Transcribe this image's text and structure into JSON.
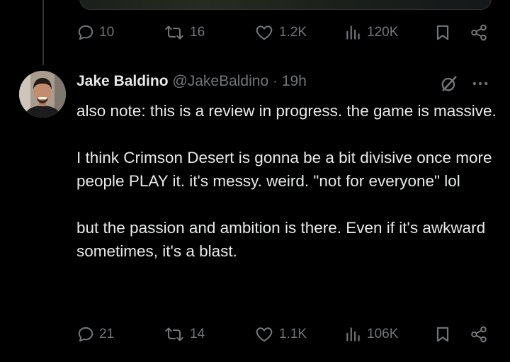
{
  "prev_tweet": {
    "replies": "10",
    "reposts": "16",
    "likes": "1.2K",
    "views": "120K"
  },
  "tweet": {
    "display_name": "Jake Baldino",
    "handle": "@JakeBaldino",
    "separator": "·",
    "time": "19h",
    "paragraphs": [
      "also note: this is a review in progress. the game is massive.",
      "I think Crimson Desert is gonna be a bit divisive once more people PLAY it. it's messy. weird. \"not for everyone\" lol",
      "but the passion and ambition is there. Even if it's awkward sometimes, it's a blast."
    ],
    "replies": "21",
    "reposts": "14",
    "likes": "1.1K",
    "views": "106K"
  },
  "icons": [
    "reply-icon",
    "repost-icon",
    "like-icon",
    "views-icon",
    "bookmark-icon",
    "share-icon",
    "grok-icon",
    "more-icon"
  ],
  "colors": {
    "background": "#000000",
    "text": "#e7e9ea",
    "secondary": "#71767b",
    "divider": "#2f3336"
  }
}
